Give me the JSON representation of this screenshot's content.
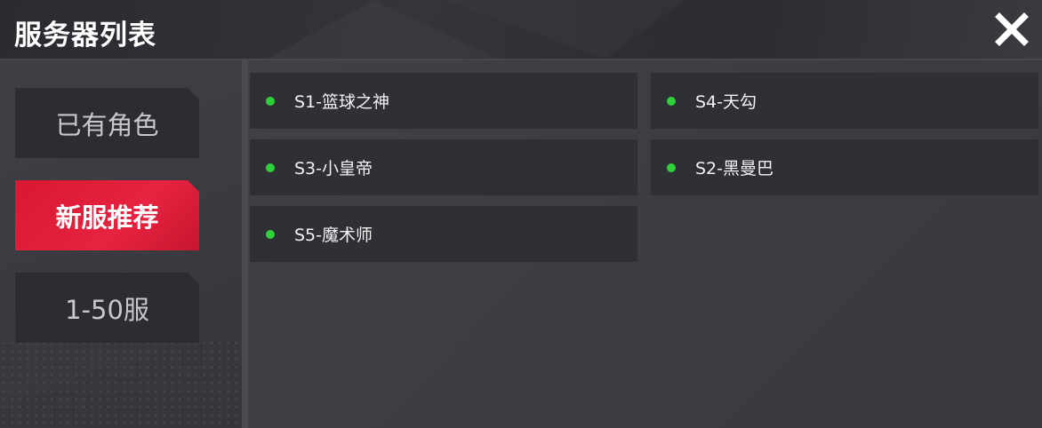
{
  "header": {
    "title": "服务器列表",
    "close_icon": "close-icon"
  },
  "sidebar": {
    "tabs": [
      {
        "label": "已有角色",
        "active": false
      },
      {
        "label": "新服推荐",
        "active": true
      },
      {
        "label": "1-50服",
        "active": false
      }
    ]
  },
  "servers": [
    {
      "name": "S1-篮球之神",
      "status": "online"
    },
    {
      "name": "S4-天勾",
      "status": "online"
    },
    {
      "name": "S3-小皇帝",
      "status": "online"
    },
    {
      "name": "S2-黑曼巴",
      "status": "online"
    },
    {
      "name": "S5-魔术师",
      "status": "online"
    }
  ],
  "colors": {
    "accent": "#e01f38",
    "online": "#2fd13a",
    "panel": "#2f3035"
  }
}
